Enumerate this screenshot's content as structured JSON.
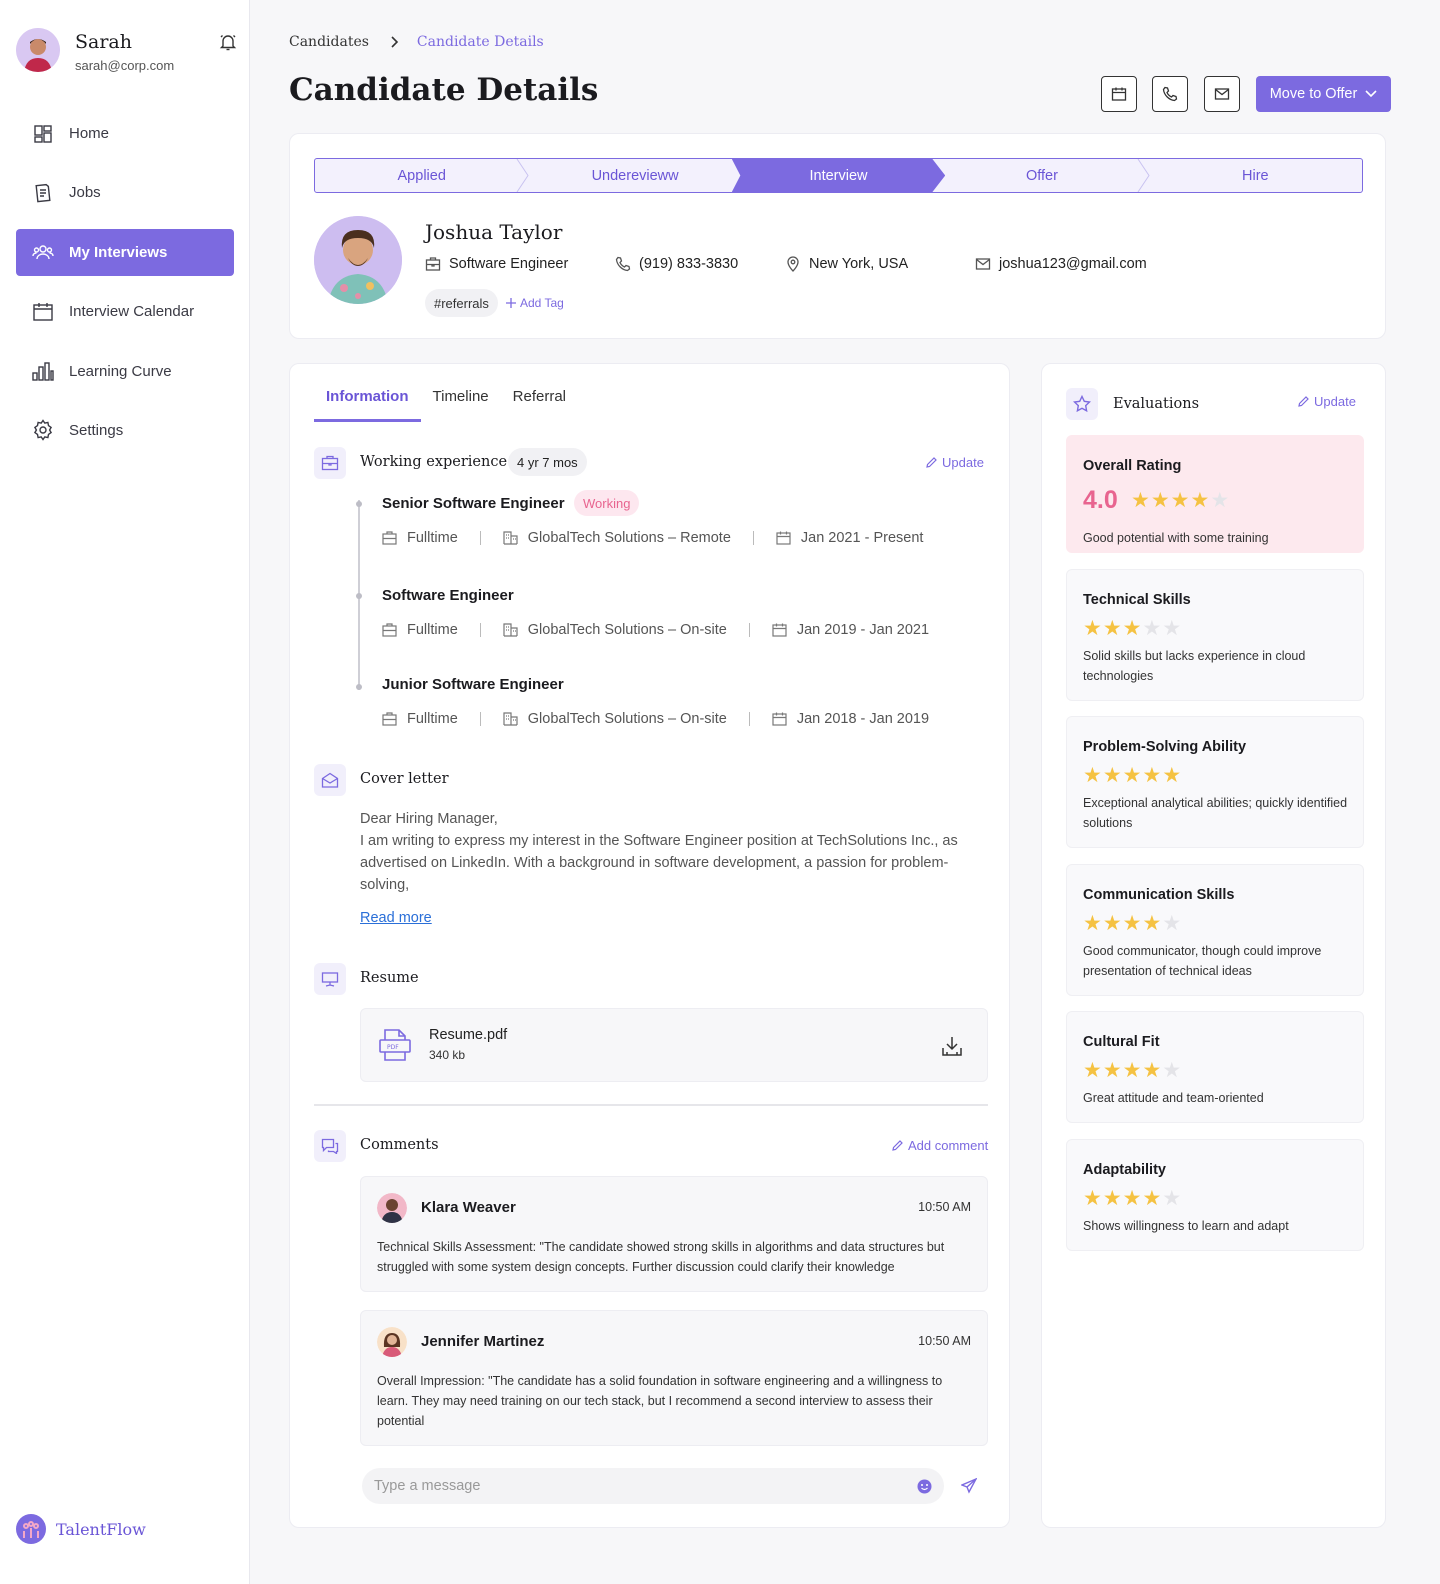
{
  "user": {
    "name": "Sarah",
    "email": "sarah@corp.com"
  },
  "nav": [
    {
      "label": "Home",
      "icon": "dashboard-icon"
    },
    {
      "label": "Jobs",
      "icon": "document-icon"
    },
    {
      "label": "My Interviews",
      "icon": "users-icon",
      "active": true
    },
    {
      "label": "Interview Calendar",
      "icon": "calendar-icon"
    },
    {
      "label": "Learning Curve",
      "icon": "bar-chart-icon"
    },
    {
      "label": "Settings",
      "icon": "gear-icon"
    }
  ],
  "brand": "TalentFlow",
  "breadcrumb": {
    "root": "Candidates",
    "current": "Candidate Details"
  },
  "page_title": "Candidate Details",
  "primary_action": "Move to Offer",
  "stages": [
    "Applied",
    "Underevieww",
    "Interview",
    "Offer",
    "Hire"
  ],
  "active_stage": 2,
  "candidate": {
    "name": "Joshua Taylor",
    "role": "Software Engineer",
    "phone": "(919) 833-3830",
    "location": "New York, USA",
    "email": "joshua123@gmail.com",
    "tag": "#referrals",
    "add_tag": "Add Tag"
  },
  "tabs": [
    "Information",
    "Timeline",
    "Referral"
  ],
  "experience": {
    "title": "Working experience",
    "duration": "4 yr 7 mos",
    "update": "Update",
    "jobs": [
      {
        "title": "Senior Software Engineer",
        "badge": "Working",
        "type": "Fulltime",
        "company": "GlobalTech Solutions – Remote",
        "period": "Jan 2021 - Present"
      },
      {
        "title": "Software Engineer",
        "type": "Fulltime",
        "company": "GlobalTech Solutions – On-site",
        "period": "Jan 2019 - Jan 2021"
      },
      {
        "title": "Junior Software Engineer",
        "type": "Fulltime",
        "company": "GlobalTech Solutions – On-site",
        "period": "Jan 2018 - Jan 2019"
      }
    ]
  },
  "cover_letter": {
    "title": "Cover letter",
    "greeting": "Dear Hiring Manager,",
    "body": "I am writing to express my interest in the Software Engineer position at TechSolutions Inc., as advertised on LinkedIn. With a background in software development, a passion for problem-solving,",
    "read_more": "Read more"
  },
  "resume": {
    "title": "Resume",
    "file_name": "Resume.pdf",
    "file_size": "340 kb"
  },
  "comments": {
    "title": "Comments",
    "add": "Add comment",
    "items": [
      {
        "author": "Klara Weaver",
        "time": "10:50 AM",
        "text": "Technical Skills Assessment: \"The candidate showed strong skills in algorithms and data structures but struggled with some system design concepts. Further discussion could clarify their knowledge"
      },
      {
        "author": "Jennifer Martinez",
        "time": "10:50 AM",
        "text": "Overall Impression: \"The candidate has a solid foundation in software engineering and a willingness to learn. They may need training on our tech stack, but I recommend a second interview to assess their potential"
      }
    ],
    "placeholder": "Type a message"
  },
  "evaluations": {
    "title": "Evaluations",
    "update": "Update",
    "overall": {
      "title": "Overall Rating",
      "score": "4.0",
      "stars": 4,
      "desc": "Good potential with some training"
    },
    "items": [
      {
        "title": "Technical Skills",
        "stars": 3,
        "desc": "Solid skills but lacks experience in cloud technologies"
      },
      {
        "title": "Problem-Solving Ability",
        "stars": 5,
        "desc": "Exceptional analytical abilities; quickly identified solutions"
      },
      {
        "title": "Communication Skills",
        "stars": 4,
        "desc": "Good communicator, though could improve presentation of technical ideas"
      },
      {
        "title": "Cultural Fit",
        "stars": 4,
        "desc": "Great attitude and team-oriented"
      },
      {
        "title": "Adaptability",
        "stars": 4,
        "desc": "Shows willingness to learn and adapt"
      }
    ]
  },
  "colors": {
    "accent": "#7c6ae0",
    "star": "#f5c242",
    "rating": "#e8648f",
    "overall_bg": "#fde9ee"
  }
}
